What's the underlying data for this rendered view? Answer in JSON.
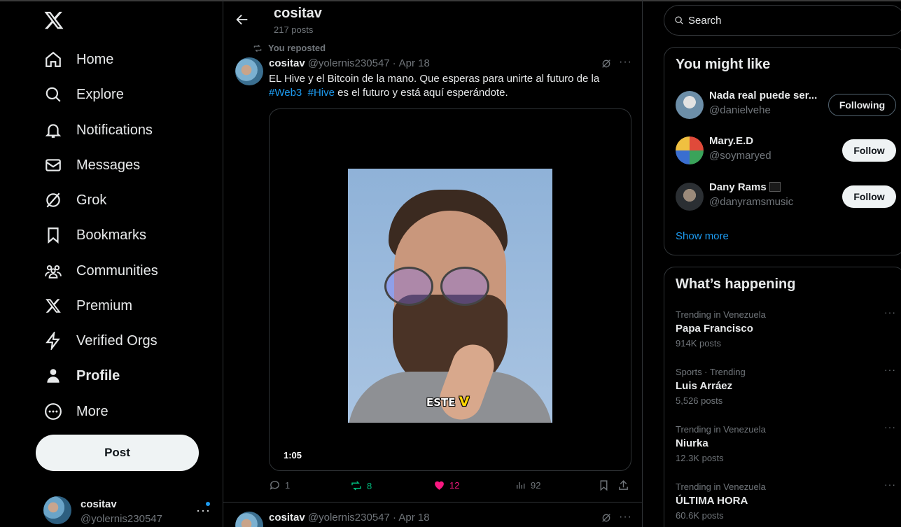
{
  "nav": {
    "items": [
      {
        "label": "Home"
      },
      {
        "label": "Explore"
      },
      {
        "label": "Notifications"
      },
      {
        "label": "Messages"
      },
      {
        "label": "Grok"
      },
      {
        "label": "Bookmarks"
      },
      {
        "label": "Communities"
      },
      {
        "label": "Premium"
      },
      {
        "label": "Verified Orgs"
      },
      {
        "label": "Profile"
      },
      {
        "label": "More"
      }
    ],
    "post_label": "Post",
    "account": {
      "name": "cositav",
      "handle": "@yolernis230547"
    }
  },
  "header": {
    "title": "cositav",
    "post_count": "217 posts"
  },
  "tweet": {
    "repost_label": "You reposted",
    "name": "cositav",
    "handle": "@yolernis230547",
    "date": "Apr 18",
    "text_line1": "EL Hive y el Bitcoin de la mano. Que esperas para unirte al futuro de la",
    "hashtag1": "#Web3",
    "hashtag2": "#Hive",
    "text_line2": "es el futuro y está aquí esperándote.",
    "video_caption": "ESTE",
    "video_caption_mark": "V",
    "video_duration": "1:05",
    "replies": "1",
    "reposts": "8",
    "likes": "12",
    "views": "92"
  },
  "tweet2": {
    "name": "cositav",
    "handle": "@yolernis230547",
    "date": "Apr 18"
  },
  "search": {
    "placeholder": "Search"
  },
  "suggestions": {
    "title": "You might like",
    "people": [
      {
        "name": "Nada real puede ser...",
        "handle": "@danielvehe",
        "button": "Following"
      },
      {
        "name": "Mary.E.D",
        "handle": "@soymaryed",
        "button": "Follow"
      },
      {
        "name": "Dany Rams",
        "handle": "@danyramsmusic",
        "button": "Follow"
      }
    ],
    "show_more": "Show more"
  },
  "trends": {
    "title": "What’s happening",
    "items": [
      {
        "context": "Trending in Venezuela",
        "name": "Papa Francisco",
        "posts": "914K posts"
      },
      {
        "context": "Sports · Trending",
        "name": "Luis Arráez",
        "posts": "5,526 posts"
      },
      {
        "context": "Trending in Venezuela",
        "name": "Niurka",
        "posts": "12.3K posts"
      },
      {
        "context": "Trending in Venezuela",
        "name": "ÚLTIMA HORA",
        "posts": "60.6K posts"
      }
    ]
  },
  "colors": {
    "accent": "#1d9bf0",
    "like": "#f91880",
    "repost": "#00ba7c",
    "muted": "#71767b"
  }
}
